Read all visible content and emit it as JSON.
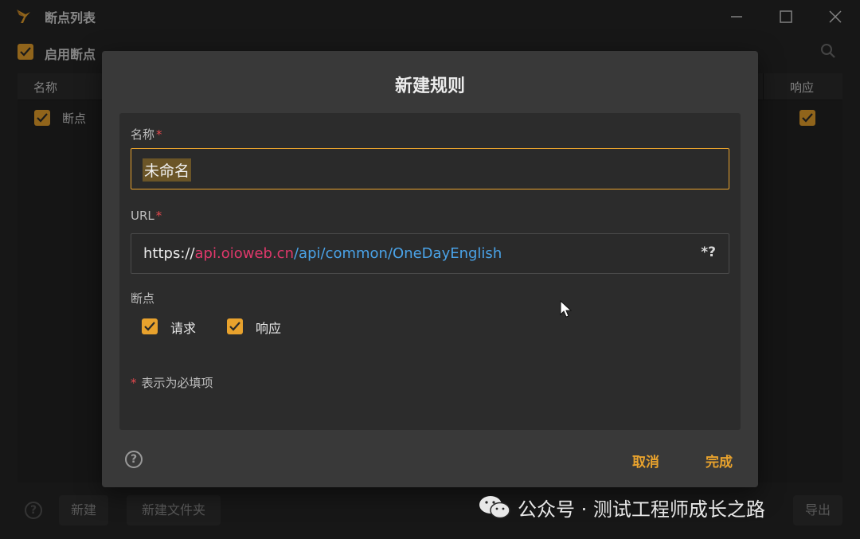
{
  "window": {
    "title": "断点列表",
    "enable_label": "启用断点"
  },
  "table": {
    "col_name": "名称",
    "col_response": "响应",
    "rows": [
      {
        "name": "断点"
      }
    ]
  },
  "bottom": {
    "new_label": "新建",
    "new_folder_label": "新建文件夹",
    "right_label": "导出"
  },
  "dialog": {
    "title": "新建规则",
    "name_label": "名称",
    "name_value": "未命名",
    "url_label": "URL",
    "url_prefix": "https://",
    "url_host": "api.oioweb.cn",
    "url_path": "/api/common/OneDayEnglish",
    "regex_label": "*?",
    "breakpoint_label": "断点",
    "request_label": "请求",
    "response_label": "响应",
    "required_asterisk": "*",
    "required_note": "表示为必填项",
    "cancel_label": "取消",
    "done_label": "完成"
  },
  "watermark": {
    "text": "公众号 · 测试工程师成长之路"
  },
  "colors": {
    "accent": "#e8a22d",
    "required": "#e5484d",
    "url_host": "#e0386b",
    "url_path": "#4aa3e8"
  }
}
